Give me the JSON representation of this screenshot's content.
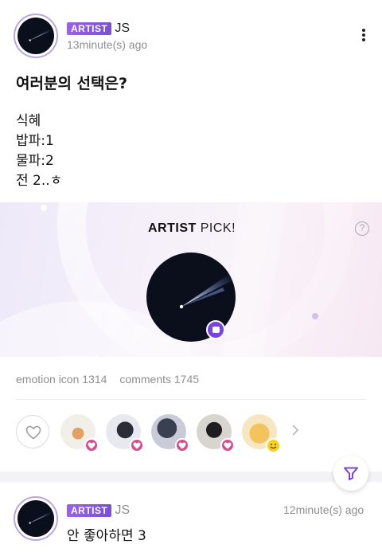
{
  "post": {
    "badge": "ARTIST",
    "author": "JS",
    "time": "13minute(s) ago",
    "menu_icon": "kebab-icon",
    "title": "여러분의 선택은?",
    "lines": [
      "식혜",
      "밥파:1",
      "물파:2",
      "전 2..ㅎ"
    ]
  },
  "pick": {
    "title_bold": "ARTIST",
    "title_rest": " PICK!",
    "help_label": "?"
  },
  "stats": {
    "emotion": "emotion icon 1314",
    "comments": "comments 1745"
  },
  "reactions": {
    "like_icon": "heart-outline-icon",
    "reactors": [
      {
        "name": "reactor-1",
        "reaction": "heart"
      },
      {
        "name": "reactor-2",
        "reaction": "heart"
      },
      {
        "name": "reactor-3",
        "reaction": "heart"
      },
      {
        "name": "reactor-4",
        "reaction": "heart"
      },
      {
        "name": "reactor-5",
        "reaction": "smile"
      }
    ]
  },
  "post2": {
    "badge": "ARTIST",
    "author": "JS",
    "time": "12minute(s) ago",
    "text": "안 좋아하면 3"
  },
  "colors": {
    "accent": "#7a43db",
    "heart": "#d84b8e",
    "badge": "#8b59e3"
  }
}
